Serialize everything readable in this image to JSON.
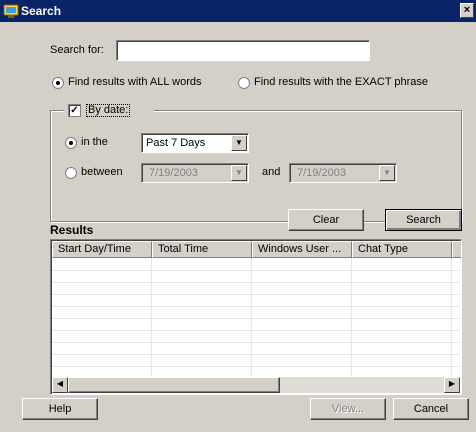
{
  "window": {
    "title": "Search",
    "close_glyph": "×"
  },
  "search": {
    "label": "Search for:",
    "value": ""
  },
  "match_mode": {
    "all_words_label": "Find results with ALL words",
    "exact_phrase_label": "Find results with the EXACT phrase",
    "selected": "all_words"
  },
  "date_filter": {
    "checkbox_label": "By date:",
    "checked": true,
    "in_the_label": "in the",
    "period_value": "Past 7 Days",
    "between_label": "between",
    "from_date": "7/19/2003",
    "and_label": "and",
    "to_date": "7/19/2003",
    "selected": "in_the"
  },
  "actions": {
    "clear_label": "Clear",
    "search_label": "Search"
  },
  "results": {
    "heading": "Results",
    "columns": [
      "Start Day/Time",
      "Total Time",
      "Windows User ...",
      "Chat Type"
    ],
    "rows": []
  },
  "footer": {
    "help_label": "Help",
    "view_label": "View...",
    "cancel_label": "Cancel"
  },
  "icons": {
    "check": "✓",
    "dropdown": "▼",
    "scroll_left": "◀",
    "scroll_right": "▶"
  }
}
